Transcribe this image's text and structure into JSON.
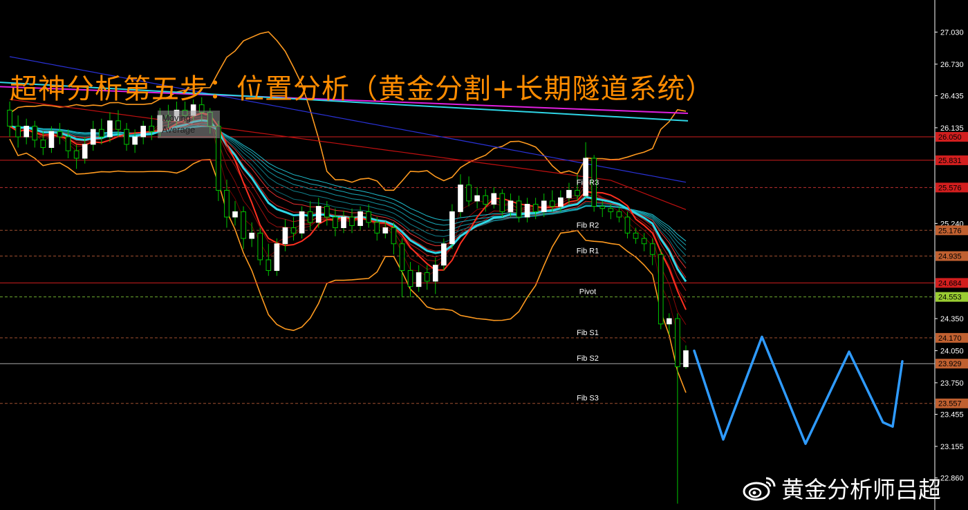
{
  "headline": "超神分析第五步：位置分析（黄金分割+长期隧道系统）",
  "ma_tooltip": [
    "Moving",
    "Average"
  ],
  "watermark": "黄金分析师吕超",
  "colors": {
    "background": "#000000",
    "axis": "#ffffff",
    "bull_candle": "#ffffff",
    "bear_candle": "#00c800",
    "bollinger": "#ff9a1f",
    "magenta_ma": "#e020e0",
    "cyan_ma": "#2fd6e6",
    "blue_ma": "#2a32d8",
    "red_ma": "#c01010",
    "projection": "#2f9bff",
    "headline": "#ff8c00"
  },
  "chart_data": {
    "type": "candlestick",
    "ylim": [
      22.56,
      27.33
    ],
    "y_ticks": [
      "27.030",
      "26.730",
      "26.435",
      "26.135",
      "25.240",
      "24.350",
      "24.050",
      "23.750",
      "23.455",
      "23.155",
      "22.860"
    ],
    "price_levels": [
      {
        "label": "Fib R3",
        "value": 25.576,
        "tag": "25.576",
        "style": "dashed",
        "color": "#c03030",
        "tag_bg": "#d21e1e"
      },
      {
        "label": "Fib R2",
        "value": 25.176,
        "tag": "25.176",
        "style": "dashed",
        "color": "#a05030",
        "tag_bg": "#c06030"
      },
      {
        "label": "Fib R1",
        "value": 24.935,
        "tag": "24.935",
        "style": "dashed",
        "color": "#a05030",
        "tag_bg": "#c06030"
      },
      {
        "label": "Pivot",
        "value": 24.553,
        "tag": "24.553",
        "style": "dashed",
        "color": "#70b030",
        "tag_bg": "#9acd32"
      },
      {
        "label": "Fib S1",
        "value": 24.17,
        "tag": "24.170",
        "style": "dashed",
        "color": "#a05030",
        "tag_bg": "#c06030"
      },
      {
        "label": "Fib S2",
        "value": 23.929,
        "tag": "23.929",
        "style": "solid",
        "color": "#aaaaaa",
        "tag_bg": "#c06030"
      },
      {
        "label": "Fib S3",
        "value": 23.557,
        "tag": "23.557",
        "style": "dashed",
        "color": "#a05030",
        "tag_bg": "#c06030"
      },
      {
        "label": "",
        "value": 26.05,
        "tag": "26.050",
        "style": "solid",
        "color": "#d21e1e",
        "tag_bg": "#d21e1e"
      },
      {
        "label": "",
        "value": 25.831,
        "tag": "25.831",
        "style": "solid",
        "color": "#d21e1e",
        "tag_bg": "#d21e1e"
      },
      {
        "label": "",
        "value": 24.684,
        "tag": "24.684",
        "style": "solid",
        "color": "#d21e1e",
        "tag_bg": "#d21e1e"
      }
    ],
    "candles": [
      [
        26.3,
        26.15,
        26.38,
        26.05
      ],
      [
        26.15,
        26.05,
        26.25,
        25.95
      ],
      [
        26.05,
        26.15,
        26.22,
        25.98
      ],
      [
        26.15,
        26.02,
        26.2,
        25.95
      ],
      [
        26.02,
        25.95,
        26.1,
        25.88
      ],
      [
        25.95,
        26.1,
        26.15,
        25.9
      ],
      [
        26.1,
        26.05,
        26.18,
        25.98
      ],
      [
        26.05,
        25.92,
        26.12,
        25.85
      ],
      [
        25.92,
        25.85,
        25.98,
        25.75
      ],
      [
        25.85,
        25.98,
        26.05,
        25.8
      ],
      [
        25.98,
        26.12,
        26.2,
        25.92
      ],
      [
        26.12,
        26.05,
        26.22,
        25.98
      ],
      [
        26.05,
        26.2,
        26.28,
        26.0
      ],
      [
        26.2,
        26.12,
        26.3,
        26.05
      ],
      [
        26.12,
        25.98,
        26.18,
        25.92
      ],
      [
        25.98,
        26.05,
        26.12,
        25.9
      ],
      [
        26.05,
        26.15,
        26.2,
        25.98
      ],
      [
        26.15,
        26.1,
        26.25,
        26.02
      ],
      [
        26.1,
        26.25,
        26.32,
        26.05
      ],
      [
        26.25,
        26.2,
        26.35,
        26.12
      ],
      [
        26.2,
        26.3,
        26.38,
        26.15
      ],
      [
        26.3,
        26.25,
        26.38,
        26.18
      ],
      [
        26.25,
        26.35,
        26.4,
        26.2
      ],
      [
        26.35,
        26.28,
        26.42,
        26.2
      ],
      [
        26.28,
        26.15,
        26.32,
        26.08
      ],
      [
        26.15,
        25.55,
        26.2,
        25.45
      ],
      [
        25.55,
        25.3,
        25.65,
        25.2
      ],
      [
        25.3,
        25.35,
        25.45,
        25.22
      ],
      [
        25.35,
        25.1,
        25.4,
        25.0
      ],
      [
        25.1,
        25.15,
        25.25,
        25.02
      ],
      [
        25.15,
        24.9,
        25.2,
        24.85
      ],
      [
        24.9,
        24.8,
        25.05,
        24.75
      ],
      [
        24.8,
        25.05,
        25.1,
        24.75
      ],
      [
        25.05,
        25.2,
        25.28,
        24.98
      ],
      [
        25.2,
        25.15,
        25.3,
        25.08
      ],
      [
        25.15,
        25.35,
        25.4,
        25.1
      ],
      [
        25.35,
        25.25,
        25.45,
        25.18
      ],
      [
        25.25,
        25.4,
        25.48,
        25.2
      ],
      [
        25.4,
        25.3,
        25.45,
        25.22
      ],
      [
        25.3,
        25.2,
        25.38,
        25.12
      ],
      [
        25.2,
        25.3,
        25.36,
        25.15
      ],
      [
        25.3,
        25.22,
        25.38,
        25.15
      ],
      [
        25.22,
        25.35,
        25.4,
        25.18
      ],
      [
        25.35,
        25.25,
        25.42,
        25.2
      ],
      [
        25.25,
        25.15,
        25.3,
        25.08
      ],
      [
        25.15,
        25.2,
        25.26,
        25.1
      ],
      [
        25.2,
        25.05,
        25.25,
        24.95
      ],
      [
        25.05,
        24.8,
        25.1,
        24.55
      ],
      [
        24.8,
        24.65,
        24.88,
        24.55
      ],
      [
        24.65,
        24.78,
        24.85,
        24.6
      ],
      [
        24.78,
        24.7,
        24.85,
        24.62
      ],
      [
        24.7,
        24.85,
        24.92,
        24.58
      ],
      [
        24.85,
        25.05,
        25.1,
        24.8
      ],
      [
        25.05,
        25.35,
        25.42,
        25.0
      ],
      [
        25.35,
        25.6,
        25.7,
        25.3
      ],
      [
        25.6,
        25.45,
        25.68,
        25.4
      ],
      [
        25.45,
        25.5,
        25.58,
        25.38
      ],
      [
        25.5,
        25.42,
        25.56,
        25.35
      ],
      [
        25.42,
        25.52,
        25.58,
        25.38
      ],
      [
        25.52,
        25.35,
        25.56,
        25.3
      ],
      [
        25.35,
        25.45,
        25.52,
        25.3
      ],
      [
        25.45,
        25.3,
        25.5,
        25.25
      ],
      [
        25.3,
        25.42,
        25.48,
        25.25
      ],
      [
        25.42,
        25.35,
        25.48,
        25.28
      ],
      [
        25.35,
        25.45,
        25.52,
        25.3
      ],
      [
        25.45,
        25.4,
        25.55,
        25.35
      ],
      [
        25.4,
        25.48,
        25.55,
        25.35
      ],
      [
        25.48,
        25.55,
        25.62,
        25.42
      ],
      [
        25.55,
        25.5,
        25.7,
        25.45
      ],
      [
        25.5,
        25.85,
        26.0,
        25.48
      ],
      [
        25.85,
        25.4,
        25.88,
        25.35
      ],
      [
        25.4,
        25.38,
        25.45,
        25.3
      ],
      [
        25.38,
        25.35,
        25.42,
        25.28
      ],
      [
        25.35,
        25.3,
        25.4,
        25.25
      ],
      [
        25.3,
        25.15,
        25.35,
        25.1
      ],
      [
        25.15,
        25.1,
        25.2,
        25.05
      ],
      [
        25.1,
        25.05,
        25.15,
        24.98
      ],
      [
        25.05,
        24.95,
        25.1,
        24.85
      ],
      [
        24.95,
        24.3,
        25.0,
        24.25
      ],
      [
        24.3,
        24.35,
        24.4,
        24.2
      ],
      [
        24.35,
        23.9,
        24.4,
        22.62
      ],
      [
        23.9,
        24.05,
        24.1,
        23.88
      ]
    ],
    "projection": [
      [
        24.05,
        0
      ],
      [
        23.22,
        6
      ],
      [
        24.18,
        14
      ],
      [
        23.18,
        23
      ],
      [
        24.04,
        32
      ],
      [
        23.38,
        39
      ],
      [
        23.34,
        41
      ],
      [
        23.95,
        43
      ]
    ]
  }
}
